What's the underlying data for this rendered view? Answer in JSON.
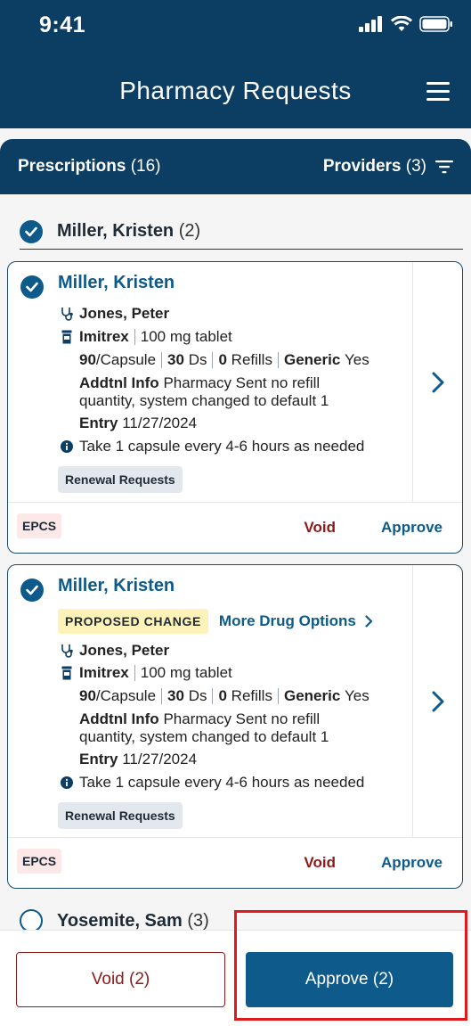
{
  "status_bar": {
    "time": "9:41"
  },
  "header": {
    "title": "Pharmacy Requests"
  },
  "tabs": {
    "prescriptions_label": "Prescriptions",
    "prescriptions_count": "(16)",
    "providers_label": "Providers",
    "providers_count": "(3)"
  },
  "group1": {
    "name": "Miller, Kristen",
    "count": "(2)"
  },
  "cards": [
    {
      "patient": "Miller, Kristen",
      "provider": "Jones, Peter",
      "drug_name": "Imitrex",
      "drug_detail": "100 mg tablet",
      "qty": "90",
      "qty_unit": "/Capsule",
      "days": "30",
      "days_unit": "Ds",
      "refills": "0",
      "refills_unit": "Refills",
      "generic_label": "Generic",
      "generic_value": "Yes",
      "addtl_label": "Addtnl Info",
      "addtl_text_1": "Pharmacy Sent no refill",
      "addtl_text_2": "quantity, system changed to default 1",
      "entry_label": "Entry",
      "entry_date": "11/27/2024",
      "sig": "Take 1 capsule every 4-6 hours as needed",
      "badge": "Renewal Requests",
      "epcs": "EPCS",
      "void": "Void",
      "approve": "Approve"
    },
    {
      "patient": "Miller, Kristen",
      "proposed": "PROPOSED CHANGE",
      "more_options": "More Drug Options",
      "provider": "Jones, Peter",
      "drug_name": "Imitrex",
      "drug_detail": "100 mg tablet",
      "qty": "90",
      "qty_unit": "/Capsule",
      "days": "30",
      "days_unit": "Ds",
      "refills": "0",
      "refills_unit": "Refills",
      "generic_label": "Generic",
      "generic_value": "Yes",
      "addtl_label": "Addtnl Info",
      "addtl_text_1": "Pharmacy Sent no refill",
      "addtl_text_2": "quantity, system changed to default 1",
      "entry_label": "Entry",
      "entry_date": "11/27/2024",
      "sig": "Take 1 capsule every 4-6 hours as needed",
      "badge": "Renewal Requests",
      "epcs": "EPCS",
      "void": "Void",
      "approve": "Approve"
    }
  ],
  "group2": {
    "name": "Yosemite, Sam",
    "count": "(3)"
  },
  "footer": {
    "void_label": "Void (2)",
    "approve_label": "Approve (2)"
  },
  "colors": {
    "primary": "#0c3d62",
    "accent": "#0e5a8a",
    "danger": "#8b1a1a",
    "highlight": "#e0191e"
  }
}
